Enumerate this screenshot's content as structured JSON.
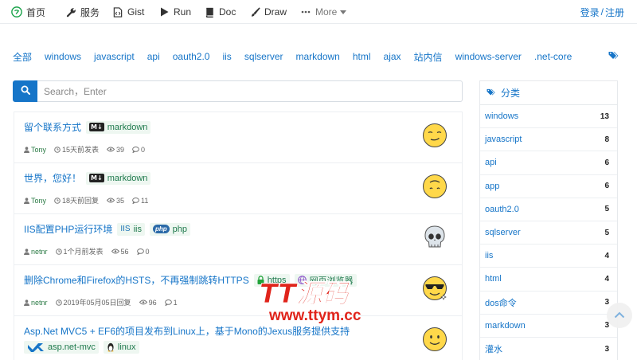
{
  "nav": {
    "items": [
      {
        "label": "首页",
        "icon": "logo-icon"
      },
      {
        "label": "服务",
        "icon": "wrench-icon"
      },
      {
        "label": "Gist",
        "icon": "code-file-icon"
      },
      {
        "label": "Run",
        "icon": "play-icon"
      },
      {
        "label": "Doc",
        "icon": "book-icon"
      },
      {
        "label": "Draw",
        "icon": "brush-icon"
      },
      {
        "label": "More",
        "icon": "ellipsis-icon"
      }
    ],
    "login": "登录",
    "separator": "/",
    "register": "注册"
  },
  "tags": [
    "全部",
    "windows",
    "javascript",
    "api",
    "oauth2.0",
    "iis",
    "sqlserver",
    "markdown",
    "html",
    "ajax",
    "站内信",
    "windows-server",
    ".net-core"
  ],
  "search": {
    "placeholder": "Search，Enter"
  },
  "posts": [
    {
      "title": "留个联系方式",
      "tags": [
        {
          "label": "markdown",
          "icon": "markdown-icon"
        }
      ],
      "author": "Tony",
      "time": "15天前发表",
      "views": "39",
      "comments": "0",
      "avatar": "smirk-face"
    },
    {
      "title": "世界，您好！",
      "tags": [
        {
          "label": "markdown",
          "icon": "markdown-icon"
        }
      ],
      "author": "Tony",
      "time": "18天前回复",
      "views": "35",
      "comments": "11",
      "avatar": "upside-down-face"
    },
    {
      "title": "IIS配置PHP运行环境",
      "tags": [
        {
          "label": "iis",
          "icon": "iis-icon"
        },
        {
          "label": "php",
          "icon": "php-icon"
        }
      ],
      "author": "netnr",
      "time": "1个月前发表",
      "views": "56",
      "comments": "0",
      "avatar": "skull"
    },
    {
      "title": "删除Chrome和Firefox的HSTS，不再强制跳转HTTPS",
      "tags": [
        {
          "label": "https",
          "icon": "lock-icon"
        },
        {
          "label": "网页浏览器",
          "icon": "globe-icon"
        }
      ],
      "author": "netnr",
      "time": "2019年05月05日回复",
      "views": "96",
      "comments": "1",
      "avatar": "sunglasses-face"
    },
    {
      "title": "Asp.Net MVC5 + EF6的项目发布到Linux上，基于Mono的Jexus服务提供支持",
      "tags": [
        {
          "label": "asp.net-mvc",
          "icon": "visual-studio-icon"
        },
        {
          "label": "linux",
          "icon": "tux-icon"
        }
      ],
      "author": "",
      "time": "",
      "views": "",
      "comments": "",
      "avatar": "smile-face"
    }
  ],
  "sidebar": {
    "title": "分类",
    "categories": [
      {
        "name": "windows",
        "count": "13"
      },
      {
        "name": "javascript",
        "count": "8"
      },
      {
        "name": "api",
        "count": "6"
      },
      {
        "name": "app",
        "count": "6"
      },
      {
        "name": "oauth2.0",
        "count": "5"
      },
      {
        "name": "sqlserver",
        "count": "5"
      },
      {
        "name": "iis",
        "count": "4"
      },
      {
        "name": "html",
        "count": "4"
      },
      {
        "name": "dos命令",
        "count": "3"
      },
      {
        "name": "markdown",
        "count": "3"
      },
      {
        "name": "灌水",
        "count": "3"
      }
    ]
  },
  "watermark": {
    "brand": "TT源码",
    "url": "www.ttym.cc"
  },
  "colors": {
    "link": "#1675c8",
    "author": "#2a7a44",
    "tagBg": "#eef7f1",
    "watermark": "#e0241b"
  }
}
